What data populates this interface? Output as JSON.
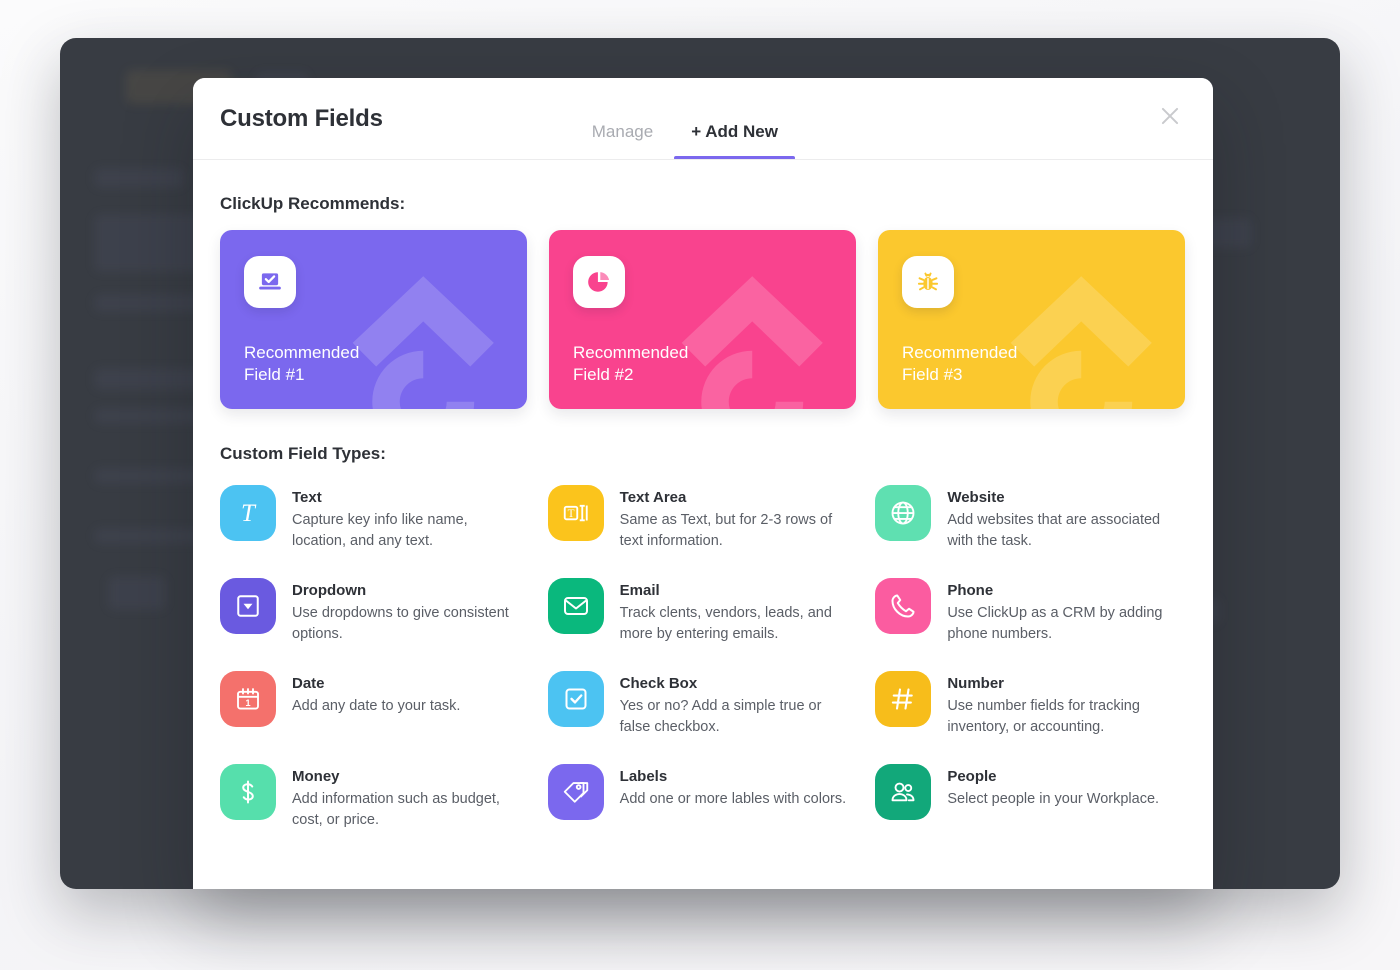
{
  "modal": {
    "title": "Custom Fields",
    "tabs": [
      {
        "label": "Manage",
        "active": false
      },
      {
        "label": "+ Add New",
        "active": true
      }
    ],
    "close_icon": "close-icon",
    "accent_color": "#7b68ee"
  },
  "recommends": {
    "heading": "ClickUp Recommends:",
    "cards": [
      {
        "label": "Recommended\nField #1",
        "color": "#7b68ee",
        "icon": "laptop-check-icon"
      },
      {
        "label": "Recommended\nField #2",
        "color": "#f9438e",
        "icon": "pie-chart-icon"
      },
      {
        "label": "Recommended\nField #3",
        "color": "#fbc82e",
        "icon": "bug-icon"
      }
    ]
  },
  "field_types": {
    "heading": "Custom Field Types:",
    "items": [
      {
        "name": "Text",
        "desc": "Capture key info like name, location, and any text.",
        "color": "#4cc3f2",
        "icon": "serif-t-icon"
      },
      {
        "name": "Text Area",
        "desc": "Same as Text, but for 2-3 rows of text information.",
        "color": "#fbc41c",
        "icon": "text-area-icon"
      },
      {
        "name": "Website",
        "desc": "Add websites that are associated with the task.",
        "color": "#5fe0b1",
        "icon": "globe-icon"
      },
      {
        "name": "Dropdown",
        "desc": "Use dropdowns to give consistent options.",
        "color": "#6a5ae0",
        "icon": "dropdown-caret-icon"
      },
      {
        "name": "Email",
        "desc": "Track clents, vendors, leads, and more by entering emails.",
        "color": "#0ab87d",
        "icon": "envelope-icon"
      },
      {
        "name": "Phone",
        "desc": "Use ClickUp as a CRM by adding phone numbers.",
        "color": "#fb5ca0",
        "icon": "phone-icon"
      },
      {
        "name": "Date",
        "desc": "Add any date to your task.",
        "color": "#f4716c",
        "icon": "calendar-icon"
      },
      {
        "name": "Check Box",
        "desc": "Yes or no? Add a simple true or false checkbox.",
        "color": "#4cc3f2",
        "icon": "checkbox-icon"
      },
      {
        "name": "Number",
        "desc": "Use number fields for tracking inventory, or accounting.",
        "color": "#f7bd1b",
        "icon": "hash-icon"
      },
      {
        "name": "Money",
        "desc": "Add information such as budget, cost, or price.",
        "color": "#56dfac",
        "icon": "dollar-icon"
      },
      {
        "name": "Labels",
        "desc": "Add one or more lables with colors.",
        "color": "#7b68ee",
        "icon": "tags-icon"
      },
      {
        "name": "People",
        "desc": "Select people in your Workplace.",
        "color": "#12a87a",
        "icon": "people-icon"
      }
    ]
  }
}
